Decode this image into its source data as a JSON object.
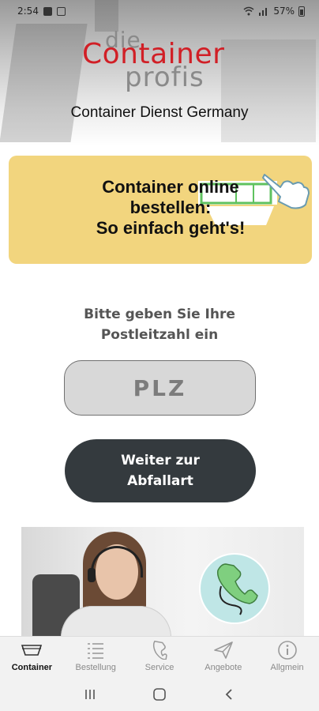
{
  "status": {
    "time": "2:54",
    "battery": "57%"
  },
  "header": {
    "logo_die": "die",
    "logo_container": "Container",
    "logo_profis": "profis",
    "company_name": "Container Dienst Germany"
  },
  "banner": {
    "title": "Container online\nbestellen:\nSo einfach geht's!"
  },
  "form": {
    "prompt": "Bitte geben Sie Ihre\nPostleitzahl ein",
    "plz_placeholder": "PLZ",
    "next_label": "Weiter zur\nAbfallart"
  },
  "bottom_nav": {
    "items": [
      {
        "label": "Container",
        "icon": "container-icon",
        "active": true
      },
      {
        "label": "Bestellung",
        "icon": "list-icon",
        "active": false
      },
      {
        "label": "Service",
        "icon": "phone-icon",
        "active": false
      },
      {
        "label": "Angebote",
        "icon": "send-icon",
        "active": false
      },
      {
        "label": "Allgmein",
        "icon": "info-icon",
        "active": false
      }
    ]
  },
  "colors": {
    "brand_red": "#d11f26",
    "banner_yellow": "#f2d57e",
    "button_dark": "#343a3e"
  }
}
